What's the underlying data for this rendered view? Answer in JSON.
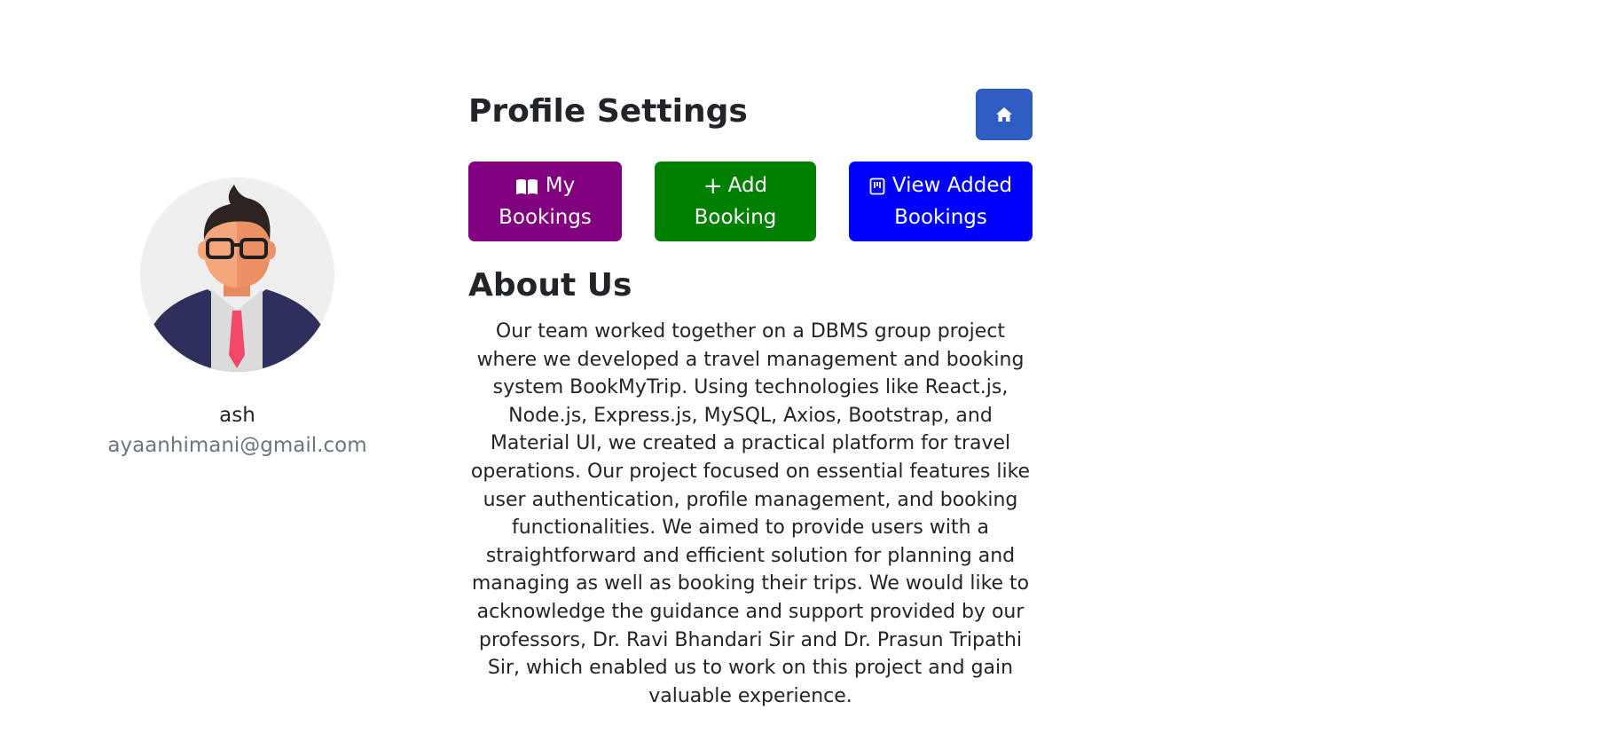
{
  "profile": {
    "name": "ash",
    "email": "ayaanhimani@gmail.com"
  },
  "settings": {
    "title": "Profile Settings",
    "home_icon": "home-icon"
  },
  "actions": {
    "my_bookings": {
      "label": "My Bookings",
      "icon": "book-icon",
      "color": "#800080"
    },
    "add_booking": {
      "label": "Add Booking",
      "icon": "plus-icon",
      "color": "#008000"
    },
    "view_added": {
      "label": "View Added Bookings",
      "icon": "list-icon",
      "color": "#0000ff"
    }
  },
  "about": {
    "title": "About Us",
    "text": "Our team worked together on a DBMS group project where we developed a travel management and booking system BookMyTrip. Using technologies like React.js, Node.js, Express.js, MySQL, Axios, Bootstrap, and Material UI, we created a practical platform for travel operations. Our project focused on essential features like user authentication, profile management, and booking functionalities. We aimed to provide users with a straightforward and efficient solution for planning and managing as well as booking their trips. We would like to acknowledge the guidance and support provided by our professors, Dr. Ravi Bhandari Sir and Dr. Prasun Tripathi Sir, which enabled us to work on this project and gain valuable experience."
  }
}
